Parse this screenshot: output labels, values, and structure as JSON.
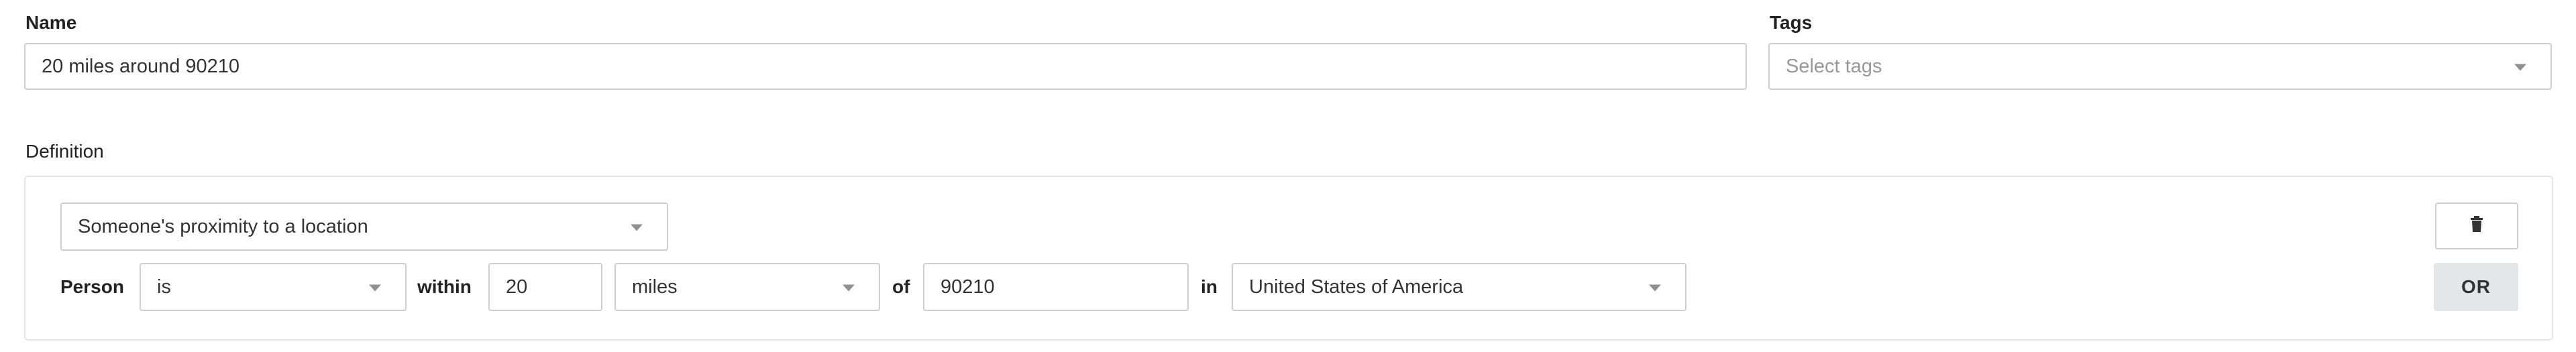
{
  "name_field": {
    "label": "Name",
    "value": "20 miles around 90210"
  },
  "tags_field": {
    "label": "Tags",
    "placeholder": "Select tags"
  },
  "definition": {
    "label": "Definition",
    "condition_type": "Someone's proximity to a location",
    "row": {
      "subject_label": "Person",
      "operator": "is",
      "within_label": "within",
      "distance": "20",
      "unit": "miles",
      "of_label": "of",
      "postal_code": "90210",
      "in_label": "in",
      "country": "United States of America"
    },
    "delete_icon": "trash-icon",
    "or_label": "OR"
  }
}
